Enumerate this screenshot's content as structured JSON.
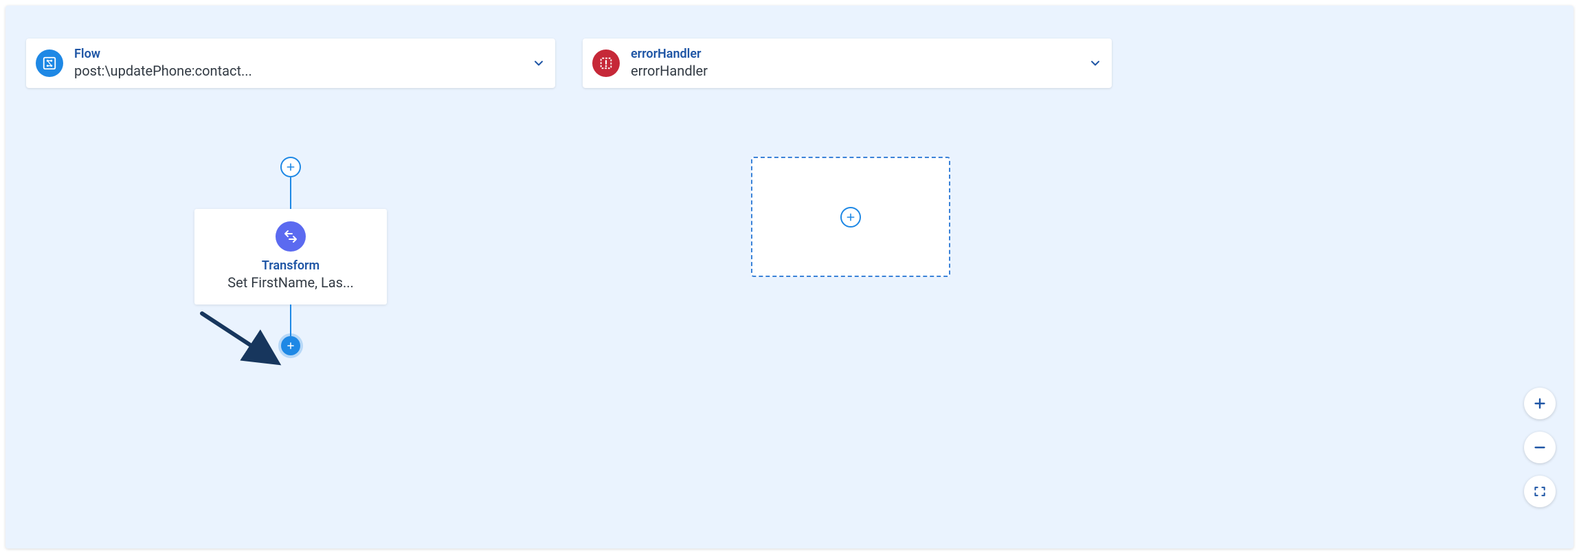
{
  "headers": {
    "flow": {
      "label": "Flow",
      "subtitle": "post:\\updatePhone:contact..."
    },
    "error": {
      "label": "errorHandler",
      "subtitle": "errorHandler"
    }
  },
  "flow_column": {
    "node": {
      "label": "Transform",
      "subtitle": "Set FirstName, Las..."
    }
  },
  "icons": {
    "flow": "flow-icon",
    "error": "error-handler-icon",
    "transform": "transform-icon",
    "plus": "+",
    "minus": "−"
  }
}
